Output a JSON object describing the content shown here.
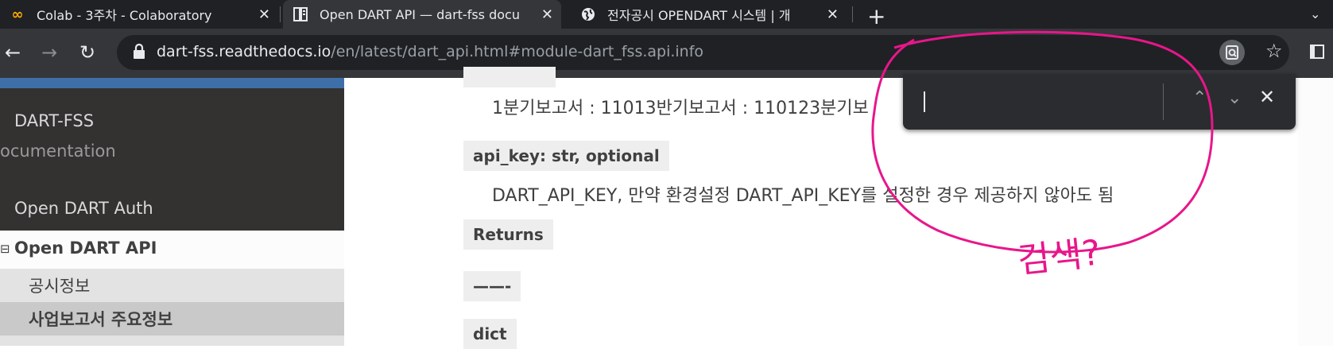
{
  "tabs": [
    {
      "title": "Colab - 3주차 - Colaboratory",
      "favicon": "colab-icon",
      "close": "✕"
    },
    {
      "title": "Open DART API — dart-fss docu",
      "favicon": "docs-icon",
      "close": "✕"
    },
    {
      "title": "전자공시 OPENDART 시스템 | 개",
      "favicon": "globe-icon",
      "close": "✕"
    }
  ],
  "new_tab": "+",
  "toolbar": {
    "back": "←",
    "forward": "→",
    "reload": "↻",
    "url_host": "dart-fss.readthedocs.io",
    "url_path": "/en/latest/dart_api.html#module-dart_fss.api.info",
    "star": "☆"
  },
  "sidebar": {
    "project": "DART-FSS",
    "documentation": "ocumentation",
    "auth": "Open DART Auth",
    "api_toggle": "⊟",
    "api": "Open DART API",
    "items": [
      "공시정보",
      "사업보고서 주요정보"
    ]
  },
  "content": {
    "line1": "1분기보고서 : 11013반기보고서 : 110123분기보",
    "param_name": "api_key: str, optional",
    "param_desc": "DART_API_KEY, 만약 환경설정 DART_API_KEY를 설정한 경우 제공하지 않아도 됨",
    "returns_label": "Returns",
    "dashes": "——-",
    "return_type": "dict"
  },
  "findbar": {
    "value": "",
    "prev": "⌃",
    "next": "⌄",
    "close": "✕"
  },
  "annotation": {
    "text": "검색?",
    "color": "#e8168a"
  },
  "colors": {
    "tab_bg": "#202124",
    "toolbar_bg": "#35363a",
    "sidebar_dark": "#343131",
    "sidebar_accent": "#3f6fa8"
  }
}
